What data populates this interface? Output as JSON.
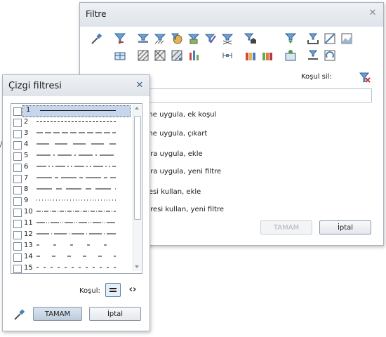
{
  "filter_dialog": {
    "title": "Filtre",
    "condition_label": "Koşul sil:",
    "options": [
      "me uygula, ek koşul",
      "me uygula, çıkart",
      "ara uygula, ekle",
      "ara uygula, yeni filtre",
      "resi kullan, ekle",
      "eresi kullan, yeni filtre"
    ],
    "ok_label": "TAMAM",
    "cancel_label": "İptal"
  },
  "line_dialog": {
    "title": "Çizgi filtresi",
    "condition_label": "Koşul:",
    "ok_label": "TAMAM",
    "cancel_label": "İptal",
    "line_types": [
      {
        "number": "1",
        "style": "solid",
        "checked": false,
        "selected": true
      },
      {
        "number": "2",
        "style": "dash",
        "checked": false,
        "selected": false
      },
      {
        "number": "3",
        "style": "dash-long",
        "checked": false,
        "selected": false
      },
      {
        "number": "4",
        "style": "long-gap",
        "checked": false,
        "selected": false
      },
      {
        "number": "5",
        "style": "dash-dot",
        "checked": false,
        "selected": false
      },
      {
        "number": "6",
        "style": "dash-dot-dot",
        "checked": false,
        "selected": false
      },
      {
        "number": "7",
        "style": "long-short",
        "checked": false,
        "selected": false
      },
      {
        "number": "8",
        "style": "long-short-gap",
        "checked": false,
        "selected": false
      },
      {
        "number": "9",
        "style": "dotted",
        "checked": false,
        "selected": false
      },
      {
        "number": "10",
        "style": "dash-dot-fine",
        "checked": false,
        "selected": false
      },
      {
        "number": "11",
        "style": "dash-dot-dot-fine",
        "checked": false,
        "selected": false
      },
      {
        "number": "12",
        "style": "long-dot",
        "checked": false,
        "selected": false
      },
      {
        "number": "13",
        "style": "sparse-dash",
        "checked": false,
        "selected": false
      },
      {
        "number": "14",
        "style": "sparse-dash-2",
        "checked": false,
        "selected": false
      },
      {
        "number": "15",
        "style": "dash-sparse-short",
        "checked": false,
        "selected": false
      }
    ]
  },
  "colors": {
    "accent": "#c6d6ec",
    "title_bg": "#e6eaef",
    "border": "#aab3bd"
  }
}
